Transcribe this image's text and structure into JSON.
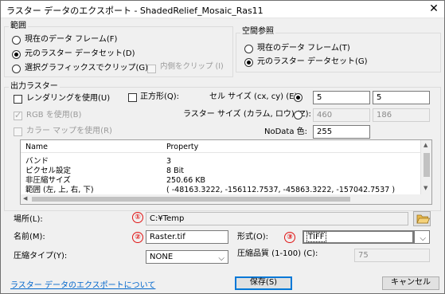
{
  "window": {
    "title": "ラスター データのエクスポート - ShadedRelief_Mosaic_Ras11",
    "close_glyph": "✕"
  },
  "extent": {
    "title": "範囲",
    "options": [
      {
        "label": "現在のデータ フレーム(F)",
        "checked": false
      },
      {
        "label": "元のラスター データセット(D)",
        "checked": true
      },
      {
        "label": "選択グラフィックスでクリップ(G)",
        "checked": false
      }
    ],
    "clip_inside_label": "内側をクリップ (I)"
  },
  "spatial_ref": {
    "title": "空間参照",
    "options": [
      {
        "label": "現在のデータ フレーム(T)",
        "checked": false
      },
      {
        "label": "元のラスター データセット(G)",
        "checked": true
      }
    ]
  },
  "output": {
    "title": "出力ラスター",
    "use_renderer_label": "レンダリングを使用(U)",
    "square_label": "正方形(Q):",
    "cell_size_label": "セル サイズ (cx, cy)  (E):",
    "cell_x": "5",
    "cell_y": "5",
    "use_rgb_label": "RGB を使用(B)",
    "raster_size_label": "ラスター サイズ (カラム, ロウ)  (Z):",
    "cols": "460",
    "rows": "186",
    "use_colormap_label": "カラー マップを使用(R)",
    "nodata_label": "NoData 色:",
    "nodata_value": "255"
  },
  "properties": {
    "header_name": "Name",
    "header_property": "Property",
    "rows": [
      {
        "name": "バンド",
        "value": "3"
      },
      {
        "name": "ピクセル設定",
        "value": "8 Bit"
      },
      {
        "name": "非圧縮サイズ",
        "value": "250.66 KB"
      },
      {
        "name": "範囲 (左, 上, 右, 下)",
        "value": "( -48163.3222, -156112.7537, -45863.3222, -157042.7537 )"
      }
    ]
  },
  "location": {
    "label": "場所(L):",
    "value": "C:¥Temp",
    "marker": "①"
  },
  "name": {
    "label": "名前(M):",
    "value": "Raster.tif",
    "marker": "②"
  },
  "format": {
    "label": "形式(O):",
    "value": "TIFF",
    "marker": "③"
  },
  "compression": {
    "type_label": "圧縮タイプ(Y):",
    "type_value": "NONE",
    "quality_label": "圧縮品質 (1-100)  (C):",
    "quality_value": "75"
  },
  "footer": {
    "help_link": "ラスター データのエクスポートについて",
    "save_label": "保存(S)",
    "cancel_label": "キャンセル"
  }
}
